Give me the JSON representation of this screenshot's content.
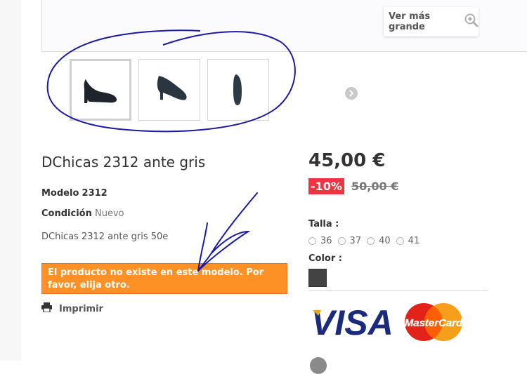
{
  "gallery": {
    "zoom_label": "Ver más grande",
    "thumbnails": [
      {
        "name": "shoe-side-view"
      },
      {
        "name": "shoe-angled-view"
      },
      {
        "name": "shoe-front-view"
      }
    ]
  },
  "product": {
    "title": "DChicas 2312 ante gris",
    "model_label": "Modelo",
    "model_value": "2312",
    "condition_label": "Condición",
    "condition_value": "Nuevo",
    "description": "DChicas 2312 ante gris 50e",
    "error_message": "El producto no existe en este modelo. Por favor, elija otro.",
    "print_label": "Imprimir"
  },
  "pricing": {
    "price": "45,00 €",
    "discount": "-10%",
    "old_price": "50,00 €"
  },
  "options": {
    "size_label": "Talla :",
    "sizes": [
      "36",
      "37",
      "40",
      "41"
    ],
    "color_label": "Color :",
    "color_swatch": "#434343"
  },
  "payment": {
    "visa": "VISA",
    "mastercard": "MasterCard"
  },
  "colors": {
    "alert_bg": "#fe9126",
    "discount_bg": "#f13340",
    "annotation": "#1a1aa8"
  }
}
